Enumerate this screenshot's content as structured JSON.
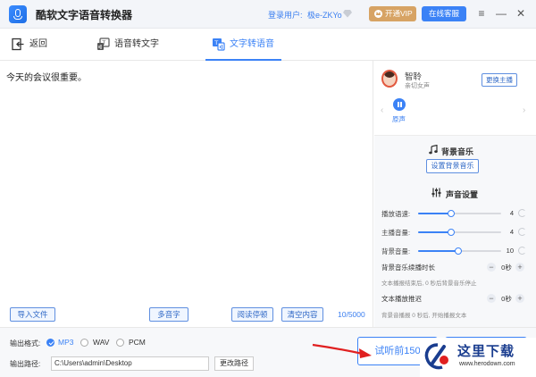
{
  "app": {
    "title": "酷软文字语音转换器",
    "login_label": "登录用户:",
    "login_user": "极e-ZKYo",
    "vip_label": "开通VIP",
    "service_label": "在线客服",
    "window_controls": {
      "menu": "≡",
      "minimize": "—",
      "close": "✕"
    }
  },
  "toolbar": {
    "back_label": "返回",
    "tabs": [
      {
        "label": "语音转文字",
        "active": false
      },
      {
        "label": "文字转语音",
        "active": true
      }
    ]
  },
  "editor": {
    "text": "今天的会议很重要。",
    "import_label": "导入文件",
    "polyphone_label": "多音字",
    "pause_label": "阅读停顿",
    "clear_label": "清空内容",
    "char_count": "10/5000"
  },
  "speaker": {
    "name": "智聆",
    "desc": "亲切女声",
    "change_label": "更换主播",
    "original_label": "原声",
    "prev_arrow": "‹",
    "next_arrow": "›"
  },
  "bg_music": {
    "title": "背景音乐",
    "set_label": "设置背景音乐"
  },
  "voice_settings": {
    "title": "声音设置",
    "sliders": [
      {
        "label": "播放语速:",
        "value": "4",
        "fraction": 0.4
      },
      {
        "label": "主播音量:",
        "value": "4",
        "fraction": 0.4
      },
      {
        "label": "背景音量:",
        "value": "10",
        "fraction": 0.48
      }
    ],
    "bg_fade": {
      "label": "背景音乐续播时长",
      "value": "0秒",
      "hint": "文本播报结束后, 0 秒后背景音乐停止"
    },
    "text_delay": {
      "label": "文本播放推迟",
      "value": "0秒",
      "hint": "背景音播报 0 秒后, 开始播报文本"
    }
  },
  "output": {
    "format_label": "输出格式:",
    "formats": [
      {
        "label": "MP3",
        "checked": true
      },
      {
        "label": "WAV",
        "checked": false
      },
      {
        "label": "PCM",
        "checked": false
      }
    ],
    "path_label": "输出路径:",
    "path_value": "C:\\Users\\admin\\Desktop",
    "change_path_label": "更改路径",
    "preview_label": "试听前150"
  },
  "watermark": {
    "text": "这里下载",
    "url": "www.herodown.com"
  },
  "colors": {
    "accent": "#3b82f6",
    "vip": "#d7a364",
    "watermark": "#1a3d8f",
    "annotation": "#e02020"
  }
}
